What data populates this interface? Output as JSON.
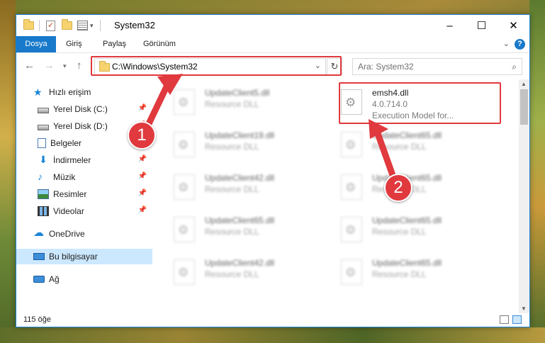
{
  "window": {
    "title": "System32",
    "controls": {
      "minimize": "–",
      "maximize": "☐",
      "close": "✕"
    }
  },
  "ribbon": {
    "tabs": [
      "Dosya",
      "Giriş",
      "Paylaş",
      "Görünüm"
    ]
  },
  "navigation": {
    "address": "C:\\Windows\\System32",
    "search_placeholder": "Ara: System32"
  },
  "sidebar": {
    "items": [
      {
        "label": "Hızlı erişim",
        "icon": "star-icon"
      },
      {
        "label": "Yerel Disk (C:)",
        "icon": "drive-icon"
      },
      {
        "label": "Yerel Disk (D:)",
        "icon": "drive-icon"
      },
      {
        "label": "Belgeler",
        "icon": "documents-icon"
      },
      {
        "label": "İndirmeler",
        "icon": "download-icon"
      },
      {
        "label": "Müzik",
        "icon": "music-icon"
      },
      {
        "label": "Resimler",
        "icon": "pictures-icon"
      },
      {
        "label": "Videolar",
        "icon": "video-icon"
      },
      {
        "label": "OneDrive",
        "icon": "cloud-icon"
      },
      {
        "label": "Bu bilgisayar",
        "icon": "computer-icon",
        "selected": true
      },
      {
        "label": "Ağ",
        "icon": "network-icon"
      }
    ]
  },
  "files": [
    {
      "name": "UpdateClient5.dll",
      "description": "Resource DLL"
    },
    {
      "name": "emsh4.dll",
      "version": "4.0.714.0",
      "description": "Execution Model for..."
    },
    {
      "name": "UpdateClient19.dll",
      "description": "Resource DLL"
    },
    {
      "name": "UpdateClient65.dll",
      "description": "Resource DLL"
    },
    {
      "name": "UpdateClient42.dll",
      "description": "Resource DLL"
    },
    {
      "name": "UpdateClient65.dll",
      "description": "Resource DLL"
    },
    {
      "name": "UpdateClient65.dll",
      "description": "Resource DLL"
    },
    {
      "name": "UpdateClient65.dll",
      "description": "Resource DLL"
    },
    {
      "name": "UpdateClient42.dll",
      "description": "Resource DLL"
    },
    {
      "name": "UpdateClient65.dll",
      "description": "Resource DLL"
    }
  ],
  "status": {
    "item_count": "115 öğe"
  },
  "annotations": {
    "step1": "1",
    "step2": "2",
    "color": "#e0393e"
  }
}
